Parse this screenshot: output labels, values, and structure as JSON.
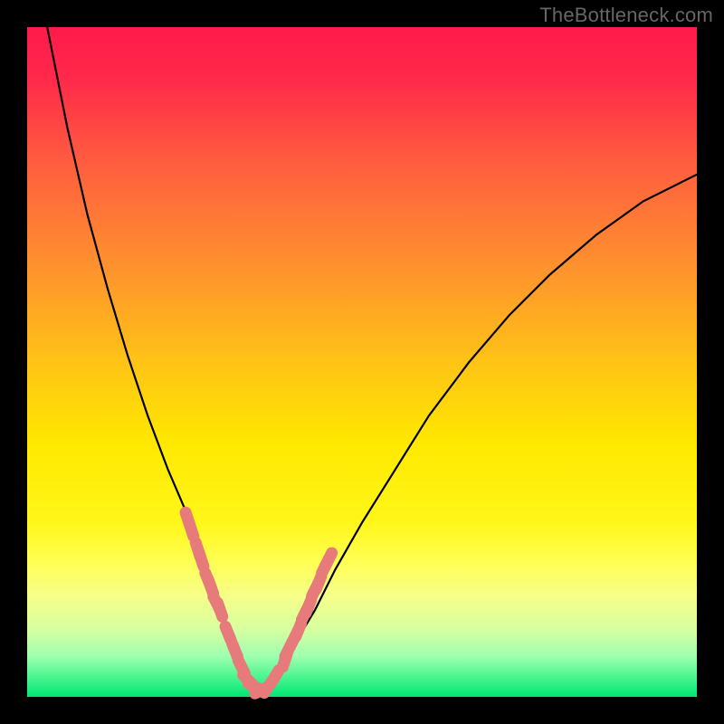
{
  "watermark": "TheBottleneck.com",
  "colors": {
    "black": "#000000",
    "gradient_stops": [
      {
        "offset": 0.0,
        "color": "#ff1a4b"
      },
      {
        "offset": 0.08,
        "color": "#ff2a4a"
      },
      {
        "offset": 0.2,
        "color": "#ff5c3f"
      },
      {
        "offset": 0.35,
        "color": "#ff8f2f"
      },
      {
        "offset": 0.5,
        "color": "#ffc316"
      },
      {
        "offset": 0.62,
        "color": "#ffe800"
      },
      {
        "offset": 0.74,
        "color": "#fff71a"
      },
      {
        "offset": 0.8,
        "color": "#ffff55"
      },
      {
        "offset": 0.85,
        "color": "#f6ff8a"
      },
      {
        "offset": 0.9,
        "color": "#d6ffa0"
      },
      {
        "offset": 0.94,
        "color": "#9dffb0"
      },
      {
        "offset": 0.97,
        "color": "#4cf58f"
      },
      {
        "offset": 1.0,
        "color": "#00e673"
      }
    ],
    "curve": "#000000",
    "marker_fill": "#e77b7b",
    "marker_stroke": "#d96565"
  },
  "chart_data": {
    "type": "line",
    "title": "",
    "xlabel": "",
    "ylabel": "",
    "xlim": [
      0,
      100
    ],
    "ylim": [
      0,
      100
    ],
    "note": "Bottleneck-style V-curve. x is normalized component ratio (0–100), y is mismatch percentage (0 = perfect match at bottom, 100 = worst at top). Values estimated from pixels; no axis ticks are shown in the source image.",
    "series": [
      {
        "name": "mismatch-curve",
        "x": [
          0,
          3,
          6,
          9,
          12,
          15,
          18,
          21,
          24,
          26,
          28,
          30,
          31,
          32,
          33,
          34,
          35,
          36,
          38,
          40,
          43,
          46,
          50,
          55,
          60,
          66,
          72,
          78,
          85,
          92,
          100
        ],
        "y": [
          118,
          100,
          85,
          72,
          61,
          51,
          42,
          34,
          27,
          21,
          15,
          10,
          7,
          4,
          2,
          1,
          1,
          2,
          4,
          8,
          13,
          19,
          26,
          34,
          42,
          50,
          57,
          63,
          69,
          74,
          78
        ]
      }
    ],
    "markers": {
      "name": "highlighted-points",
      "x": [
        24.0,
        24.5,
        25.5,
        26.0,
        27.0,
        27.4,
        28.3,
        28.8,
        30.0,
        31.0,
        32.0,
        33.0,
        34.0,
        35.0,
        36.0,
        37.0,
        38.5,
        39.0,
        40.0,
        40.5,
        41.5,
        42.0,
        43.0,
        43.5,
        44.5,
        45.0
      ],
      "y": [
        26.5,
        25.0,
        22.0,
        20.5,
        17.5,
        16.5,
        14.0,
        13.0,
        9.5,
        7.0,
        4.5,
        2.5,
        1.5,
        1.0,
        1.5,
        3.0,
        5.5,
        7.0,
        9.0,
        10.0,
        12.5,
        13.5,
        16.0,
        17.0,
        19.5,
        20.5
      ]
    }
  }
}
